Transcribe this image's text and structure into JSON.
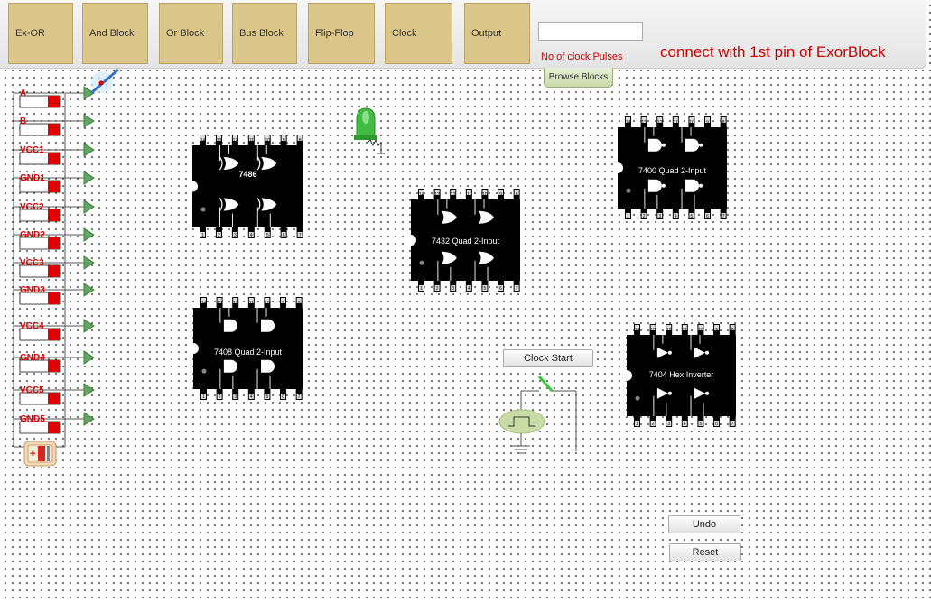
{
  "toolbar": {
    "buttons": [
      {
        "label": "Ex-OR"
      },
      {
        "label": "And Block"
      },
      {
        "label": "Or Block"
      },
      {
        "label": "Bus Block"
      },
      {
        "label": "Flip-Flop"
      },
      {
        "label": "Clock"
      },
      {
        "label": "Output"
      }
    ],
    "pulse_input_value": "",
    "pulse_label": "No of clock Pulses",
    "status_message": "connect with 1st pin of ExorBlock",
    "browse_label": "Browse Blocks"
  },
  "switches": [
    "A",
    "B",
    "VCC1",
    "GND1",
    "VCC2",
    "GND2",
    "VCC3",
    "GND3",
    "VCC4",
    "GND4",
    "VCC5",
    "GND5"
  ],
  "chips": [
    {
      "label": "7486",
      "pins_top": [
        "14",
        "13",
        "12",
        "11",
        "10",
        "9",
        "8"
      ],
      "pins_bottom": [
        "1",
        "2",
        "3",
        "4",
        "5",
        "6",
        "7"
      ]
    },
    {
      "label": "7432 Quad 2-Input",
      "pins_top": [
        "14",
        "13",
        "12",
        "11",
        "10",
        "9",
        "8"
      ],
      "pins_bottom": [
        "1",
        "2",
        "3",
        "4",
        "5",
        "6",
        "7"
      ]
    },
    {
      "label": "7400 Quad 2-Input",
      "pins_top": [
        "14",
        "13",
        "12",
        "11",
        "10",
        "9",
        "8"
      ],
      "pins_bottom": [
        "1",
        "2",
        "3",
        "4",
        "5",
        "6",
        "7"
      ]
    },
    {
      "label": "7408 Quad 2-Input",
      "pins_top": [
        "14",
        "13",
        "12",
        "11",
        "10",
        "9",
        "8"
      ],
      "pins_bottom": [
        "1",
        "2",
        "3",
        "4",
        "5",
        "6",
        "7"
      ]
    },
    {
      "label": "7404 Hex Inverter",
      "pins_top": [
        "14",
        "13",
        "12",
        "11",
        "10",
        "9",
        "8"
      ],
      "pins_bottom": [
        "1",
        "2",
        "3",
        "4",
        "5",
        "6",
        "7"
      ]
    }
  ],
  "clock_start_label": "Clock Start",
  "undo_label": "Undo",
  "reset_label": "Reset",
  "colors": {
    "switch_red": "#e00000",
    "toolbar_button": "#dcc78a",
    "chip": "#000000",
    "led": "#33aa33",
    "probe_green": "#5fa85f"
  }
}
